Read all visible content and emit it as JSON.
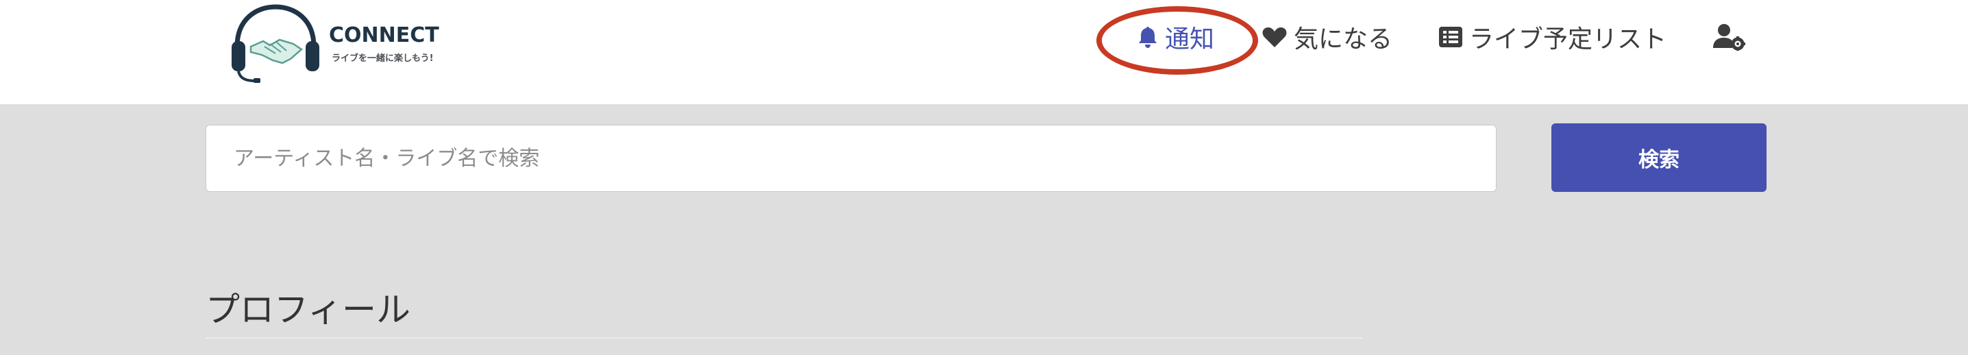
{
  "brand": {
    "name": "CONNECT",
    "tagline": "ライブを一緒に楽しもう!"
  },
  "nav": {
    "notifications": {
      "label": "通知",
      "icon": "bell-icon"
    },
    "favorites": {
      "label": "気になる",
      "icon": "heart-icon"
    },
    "schedule": {
      "label": "ライブ予定リスト",
      "icon": "list-icon"
    },
    "account": {
      "icon": "user-settings-icon"
    }
  },
  "search": {
    "placeholder": "アーティスト名・ライブ名で検索",
    "value": "",
    "button_label": "検索"
  },
  "profile": {
    "title": "プロフィール"
  },
  "colors": {
    "accent": "#4550b0",
    "highlight": "#c83a22",
    "header_bg": "#ffffff",
    "page_bg": "#dedede"
  }
}
